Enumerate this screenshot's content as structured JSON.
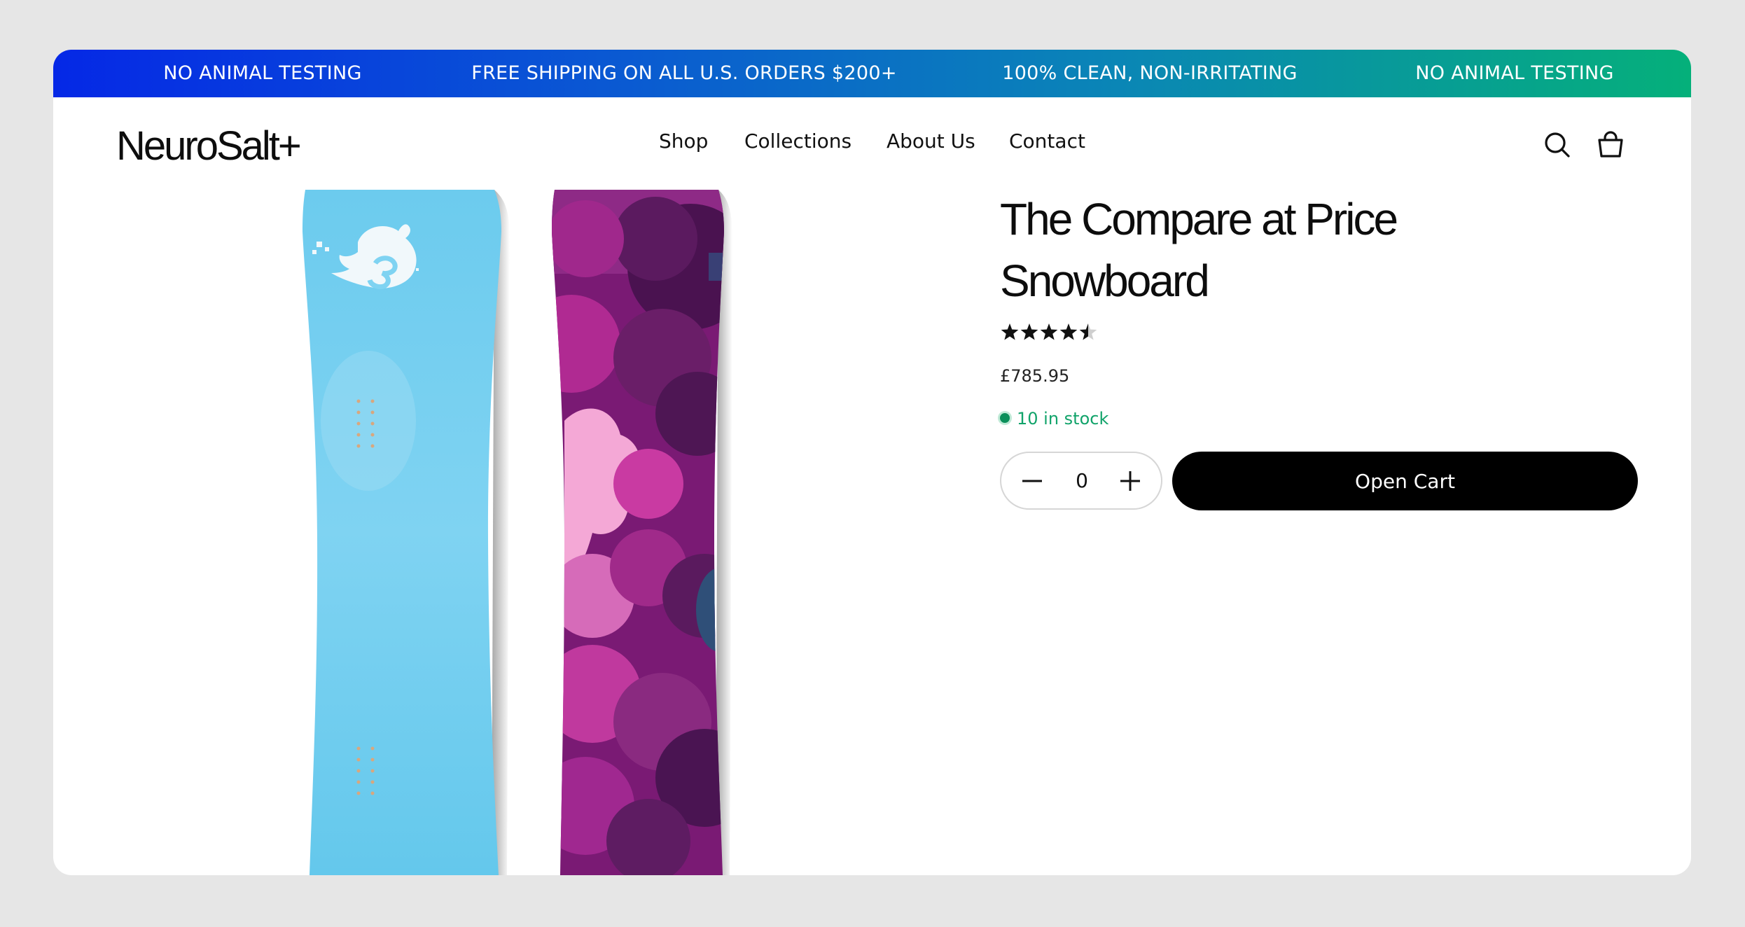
{
  "announcement": {
    "items": [
      "NO ANIMAL TESTING",
      "FREE SHIPPING ON ALL U.S. ORDERS $200+",
      "100% CLEAN, NON-IRRITATING",
      "NO ANIMAL TESTING"
    ]
  },
  "header": {
    "logo": "NeuroSalt+",
    "nav": [
      "Shop",
      "Collections",
      "About Us",
      "Contact"
    ],
    "icons": [
      "search-icon",
      "cart-bag-icon"
    ]
  },
  "product": {
    "title": "The Compare at Price Snowboard",
    "rating": 4.5,
    "rating_max": 5,
    "price": "£785.95",
    "stock": "10 in stock",
    "quantity": "0",
    "cart_button": "Open Cart"
  },
  "colors": {
    "accent_black": "#000000",
    "stock_green": "#11a36a",
    "banner_start": "#0528e6",
    "banner_end": "#05b07a"
  }
}
